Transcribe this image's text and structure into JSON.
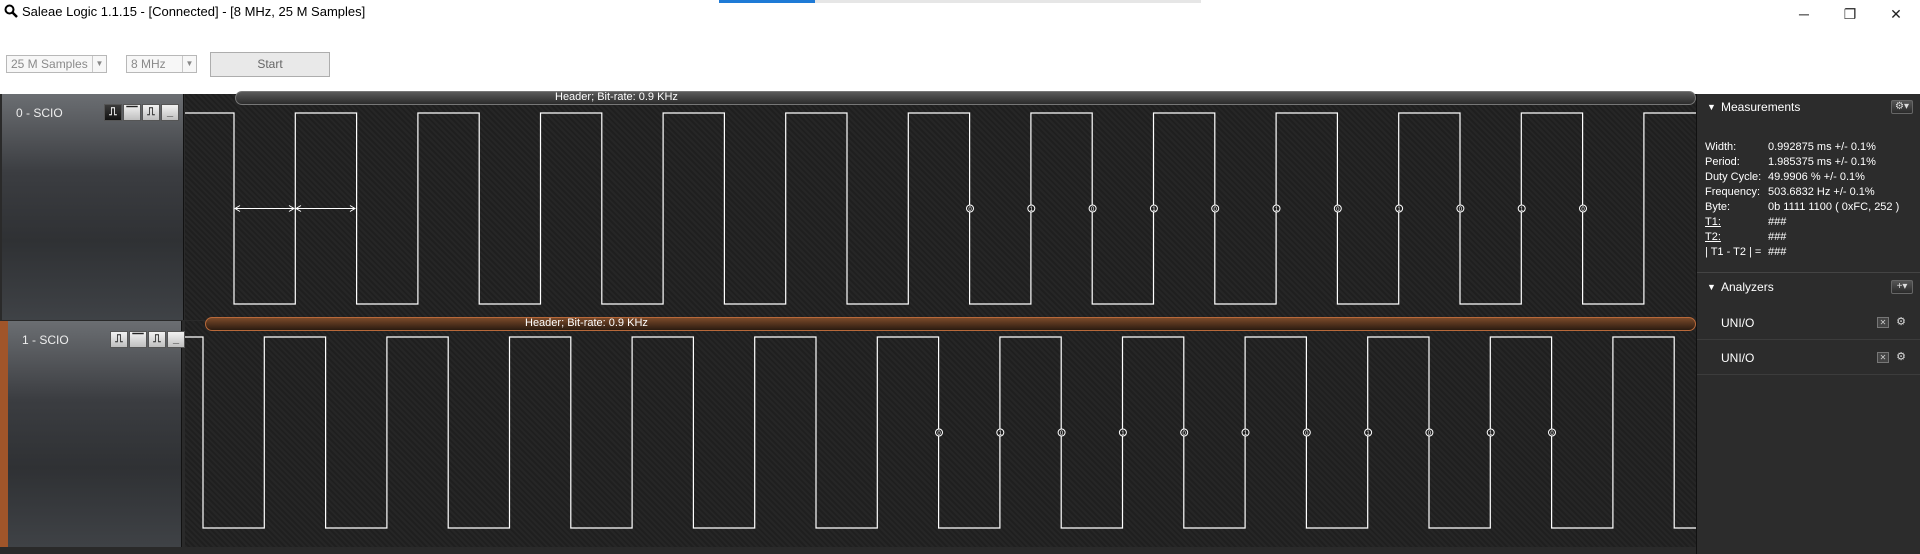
{
  "window": {
    "title": "Saleae Logic 1.1.15 - [Connected] - [8 MHz, 25 M Samples]",
    "icon": "search-icon",
    "controls": {
      "minimize": "─",
      "maximize": "❐",
      "close": "✕"
    },
    "progress": 0.2
  },
  "toolbar": {
    "samples": "25 M Samples",
    "rate": "8 MHz",
    "start_label": "Start"
  },
  "channels": [
    {
      "name": "0 - SCIO",
      "accent": "#5a5a5a",
      "trigger_buttons": [
        "⎍",
        "⎺",
        "⎍",
        "_"
      ],
      "annotation": "Header; Bit-rate: 0.9 KHz",
      "bits": [
        "0",
        "1",
        "0",
        "1",
        "0",
        "1",
        "0",
        "1",
        "0",
        "1",
        "0"
      ]
    },
    {
      "name": "1 - SCIO",
      "accent": "#a0552a",
      "trigger_buttons": [
        "⎍",
        "⎺",
        "⎍",
        "_"
      ],
      "annotation": "Header; Bit-rate: 0.9 KHz",
      "bits": [
        "0",
        "1",
        "0",
        "1",
        "0",
        "1",
        "0",
        "1",
        "0",
        "1",
        "0"
      ]
    }
  ],
  "measurements": {
    "title": "Measurements",
    "rows": [
      {
        "k": "Width:",
        "v": "0.992875 ms +/- 0.1%"
      },
      {
        "k": "Period:",
        "v": "1.985375 ms +/- 0.1%"
      },
      {
        "k": "Duty Cycle:",
        "v": "49.9906 % +/- 0.1%"
      },
      {
        "k": "Frequency:",
        "v": "503.6832 Hz +/- 0.1%"
      },
      {
        "k": "Byte:",
        "v": "0b 1111 1100 ( 0xFC, 252 )"
      },
      {
        "k": "T1:",
        "v": "###"
      },
      {
        "k": "T2:",
        "v": "###"
      },
      {
        "k": "| T1 - T2 | =",
        "v": "###"
      }
    ]
  },
  "analyzers": {
    "title": "Analyzers",
    "add_label": "+▾",
    "items": [
      "UNI/O",
      "UNI/O"
    ]
  },
  "colors": {
    "signal": "#ffffff",
    "accent_ch1": "#a0552a"
  }
}
